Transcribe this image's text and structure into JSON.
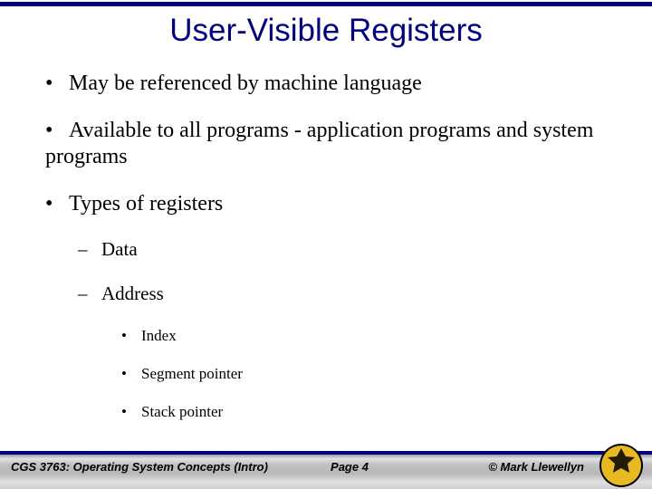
{
  "slide": {
    "title": "User-Visible Registers",
    "bullets": [
      "May be referenced by machine language",
      "Available to all programs - application programs and system programs",
      "Types of registers"
    ],
    "subbullets": {
      "b2_sub0": "Data",
      "b2_sub1": "Address"
    },
    "subsub": {
      "s0": "Index",
      "s1": "Segment pointer",
      "s2": "Stack pointer"
    }
  },
  "footer": {
    "left": "CGS 3763: Operating System Concepts  (Intro)",
    "center_prefix": "Page ",
    "page": "4",
    "right": "© Mark Llewellyn"
  },
  "colors": {
    "rule": "#000080",
    "title": "#000080"
  }
}
